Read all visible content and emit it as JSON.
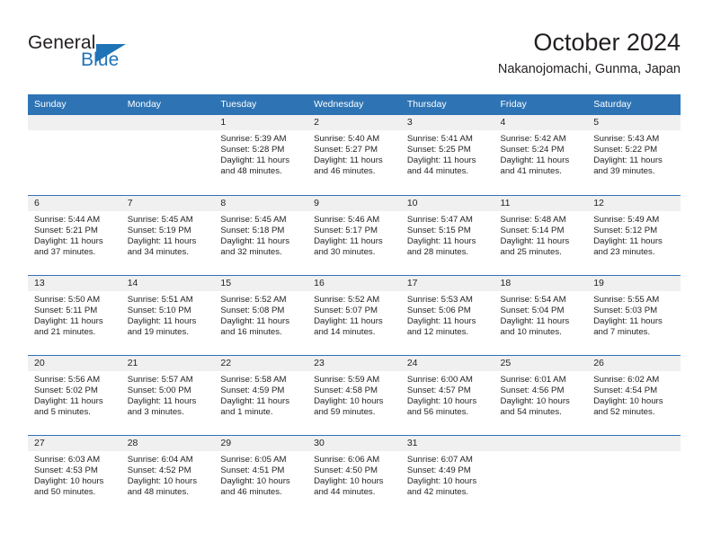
{
  "brand": {
    "name_top": "General",
    "name_bottom": "Blue",
    "accent_color": "#1f73b7"
  },
  "header": {
    "title": "October 2024",
    "subtitle": "Nakanojomachi, Gunma, Japan"
  },
  "theme": {
    "header_bar_color": "#2e74b5",
    "daynum_band_color": "#f0f0f0",
    "text_color": "#231f20"
  },
  "weekday_headers": [
    "Sunday",
    "Monday",
    "Tuesday",
    "Wednesday",
    "Thursday",
    "Friday",
    "Saturday"
  ],
  "weeks": [
    [
      {
        "day": "",
        "empty": true
      },
      {
        "day": "",
        "empty": true
      },
      {
        "day": "1",
        "sunrise": "Sunrise: 5:39 AM",
        "sunset": "Sunset: 5:28 PM",
        "daylight_1": "Daylight: 11 hours",
        "daylight_2": "and 48 minutes."
      },
      {
        "day": "2",
        "sunrise": "Sunrise: 5:40 AM",
        "sunset": "Sunset: 5:27 PM",
        "daylight_1": "Daylight: 11 hours",
        "daylight_2": "and 46 minutes."
      },
      {
        "day": "3",
        "sunrise": "Sunrise: 5:41 AM",
        "sunset": "Sunset: 5:25 PM",
        "daylight_1": "Daylight: 11 hours",
        "daylight_2": "and 44 minutes."
      },
      {
        "day": "4",
        "sunrise": "Sunrise: 5:42 AM",
        "sunset": "Sunset: 5:24 PM",
        "daylight_1": "Daylight: 11 hours",
        "daylight_2": "and 41 minutes."
      },
      {
        "day": "5",
        "sunrise": "Sunrise: 5:43 AM",
        "sunset": "Sunset: 5:22 PM",
        "daylight_1": "Daylight: 11 hours",
        "daylight_2": "and 39 minutes."
      }
    ],
    [
      {
        "day": "6",
        "sunrise": "Sunrise: 5:44 AM",
        "sunset": "Sunset: 5:21 PM",
        "daylight_1": "Daylight: 11 hours",
        "daylight_2": "and 37 minutes."
      },
      {
        "day": "7",
        "sunrise": "Sunrise: 5:45 AM",
        "sunset": "Sunset: 5:19 PM",
        "daylight_1": "Daylight: 11 hours",
        "daylight_2": "and 34 minutes."
      },
      {
        "day": "8",
        "sunrise": "Sunrise: 5:45 AM",
        "sunset": "Sunset: 5:18 PM",
        "daylight_1": "Daylight: 11 hours",
        "daylight_2": "and 32 minutes."
      },
      {
        "day": "9",
        "sunrise": "Sunrise: 5:46 AM",
        "sunset": "Sunset: 5:17 PM",
        "daylight_1": "Daylight: 11 hours",
        "daylight_2": "and 30 minutes."
      },
      {
        "day": "10",
        "sunrise": "Sunrise: 5:47 AM",
        "sunset": "Sunset: 5:15 PM",
        "daylight_1": "Daylight: 11 hours",
        "daylight_2": "and 28 minutes."
      },
      {
        "day": "11",
        "sunrise": "Sunrise: 5:48 AM",
        "sunset": "Sunset: 5:14 PM",
        "daylight_1": "Daylight: 11 hours",
        "daylight_2": "and 25 minutes."
      },
      {
        "day": "12",
        "sunrise": "Sunrise: 5:49 AM",
        "sunset": "Sunset: 5:12 PM",
        "daylight_1": "Daylight: 11 hours",
        "daylight_2": "and 23 minutes."
      }
    ],
    [
      {
        "day": "13",
        "sunrise": "Sunrise: 5:50 AM",
        "sunset": "Sunset: 5:11 PM",
        "daylight_1": "Daylight: 11 hours",
        "daylight_2": "and 21 minutes."
      },
      {
        "day": "14",
        "sunrise": "Sunrise: 5:51 AM",
        "sunset": "Sunset: 5:10 PM",
        "daylight_1": "Daylight: 11 hours",
        "daylight_2": "and 19 minutes."
      },
      {
        "day": "15",
        "sunrise": "Sunrise: 5:52 AM",
        "sunset": "Sunset: 5:08 PM",
        "daylight_1": "Daylight: 11 hours",
        "daylight_2": "and 16 minutes."
      },
      {
        "day": "16",
        "sunrise": "Sunrise: 5:52 AM",
        "sunset": "Sunset: 5:07 PM",
        "daylight_1": "Daylight: 11 hours",
        "daylight_2": "and 14 minutes."
      },
      {
        "day": "17",
        "sunrise": "Sunrise: 5:53 AM",
        "sunset": "Sunset: 5:06 PM",
        "daylight_1": "Daylight: 11 hours",
        "daylight_2": "and 12 minutes."
      },
      {
        "day": "18",
        "sunrise": "Sunrise: 5:54 AM",
        "sunset": "Sunset: 5:04 PM",
        "daylight_1": "Daylight: 11 hours",
        "daylight_2": "and 10 minutes."
      },
      {
        "day": "19",
        "sunrise": "Sunrise: 5:55 AM",
        "sunset": "Sunset: 5:03 PM",
        "daylight_1": "Daylight: 11 hours",
        "daylight_2": "and 7 minutes."
      }
    ],
    [
      {
        "day": "20",
        "sunrise": "Sunrise: 5:56 AM",
        "sunset": "Sunset: 5:02 PM",
        "daylight_1": "Daylight: 11 hours",
        "daylight_2": "and 5 minutes."
      },
      {
        "day": "21",
        "sunrise": "Sunrise: 5:57 AM",
        "sunset": "Sunset: 5:00 PM",
        "daylight_1": "Daylight: 11 hours",
        "daylight_2": "and 3 minutes."
      },
      {
        "day": "22",
        "sunrise": "Sunrise: 5:58 AM",
        "sunset": "Sunset: 4:59 PM",
        "daylight_1": "Daylight: 11 hours",
        "daylight_2": "and 1 minute."
      },
      {
        "day": "23",
        "sunrise": "Sunrise: 5:59 AM",
        "sunset": "Sunset: 4:58 PM",
        "daylight_1": "Daylight: 10 hours",
        "daylight_2": "and 59 minutes."
      },
      {
        "day": "24",
        "sunrise": "Sunrise: 6:00 AM",
        "sunset": "Sunset: 4:57 PM",
        "daylight_1": "Daylight: 10 hours",
        "daylight_2": "and 56 minutes."
      },
      {
        "day": "25",
        "sunrise": "Sunrise: 6:01 AM",
        "sunset": "Sunset: 4:56 PM",
        "daylight_1": "Daylight: 10 hours",
        "daylight_2": "and 54 minutes."
      },
      {
        "day": "26",
        "sunrise": "Sunrise: 6:02 AM",
        "sunset": "Sunset: 4:54 PM",
        "daylight_1": "Daylight: 10 hours",
        "daylight_2": "and 52 minutes."
      }
    ],
    [
      {
        "day": "27",
        "sunrise": "Sunrise: 6:03 AM",
        "sunset": "Sunset: 4:53 PM",
        "daylight_1": "Daylight: 10 hours",
        "daylight_2": "and 50 minutes."
      },
      {
        "day": "28",
        "sunrise": "Sunrise: 6:04 AM",
        "sunset": "Sunset: 4:52 PM",
        "daylight_1": "Daylight: 10 hours",
        "daylight_2": "and 48 minutes."
      },
      {
        "day": "29",
        "sunrise": "Sunrise: 6:05 AM",
        "sunset": "Sunset: 4:51 PM",
        "daylight_1": "Daylight: 10 hours",
        "daylight_2": "and 46 minutes."
      },
      {
        "day": "30",
        "sunrise": "Sunrise: 6:06 AM",
        "sunset": "Sunset: 4:50 PM",
        "daylight_1": "Daylight: 10 hours",
        "daylight_2": "and 44 minutes."
      },
      {
        "day": "31",
        "sunrise": "Sunrise: 6:07 AM",
        "sunset": "Sunset: 4:49 PM",
        "daylight_1": "Daylight: 10 hours",
        "daylight_2": "and 42 minutes."
      },
      {
        "day": "",
        "empty": true
      },
      {
        "day": "",
        "empty": true
      }
    ]
  ]
}
